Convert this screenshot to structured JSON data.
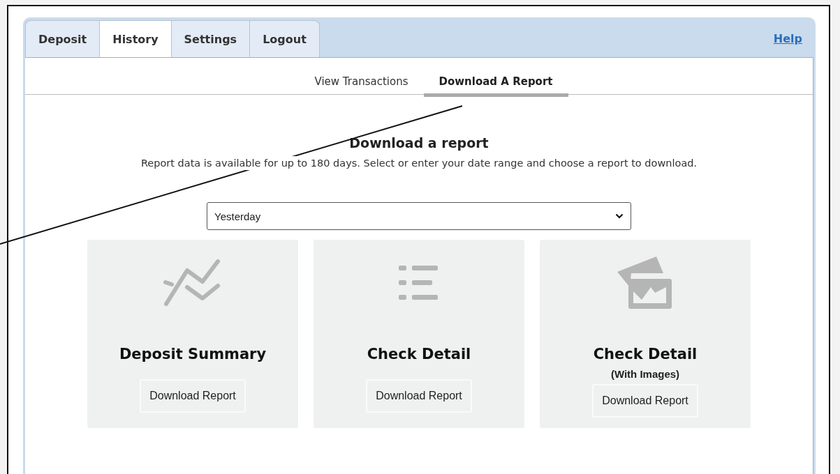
{
  "tabs": [
    {
      "label": "Deposit",
      "selected": false
    },
    {
      "label": "History",
      "selected": true
    },
    {
      "label": "Settings",
      "selected": false
    },
    {
      "label": "Logout",
      "selected": false
    }
  ],
  "help_link": "Help",
  "subtabs": [
    {
      "label": "View Transactions",
      "selected": false
    },
    {
      "label": "Download A Report",
      "selected": true
    }
  ],
  "heading": "Download a report",
  "description": "Report data is available for up to 180 days. Select or enter your date range and choose a report to download.",
  "date_range": {
    "value": "Yesterday"
  },
  "reports": [
    {
      "kind": "chart",
      "title": "Deposit Summary",
      "button": "Download Report"
    },
    {
      "kind": "list",
      "title": "Check Detail",
      "button": "Download Report"
    },
    {
      "kind": "images",
      "title": "Check Detail",
      "subtitle": "(With Images)",
      "button": "Download Report"
    }
  ]
}
